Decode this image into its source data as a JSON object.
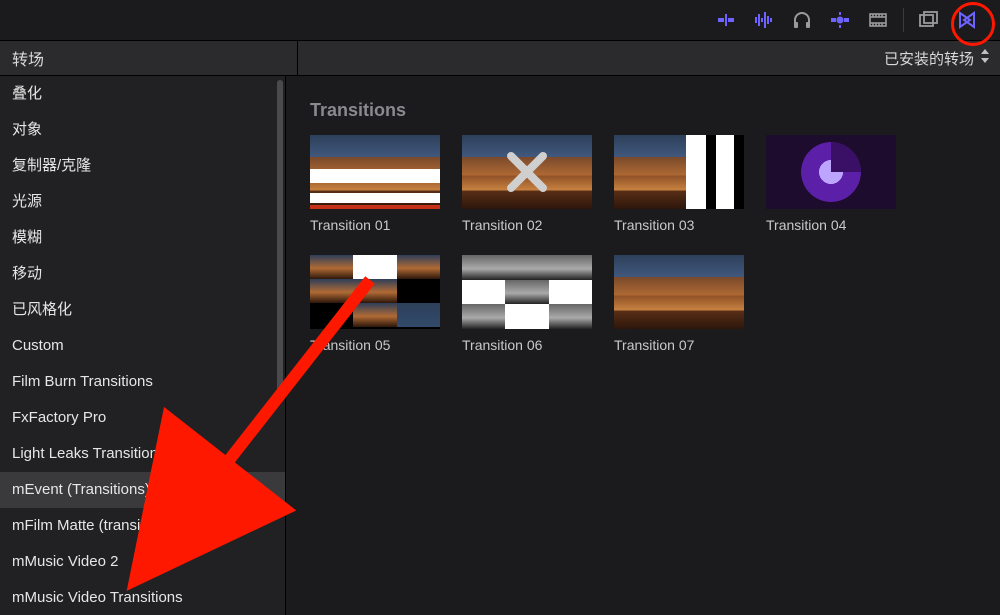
{
  "header": {
    "category_label": "转场",
    "filter_label": "已安装的转场"
  },
  "sidebar": {
    "items": [
      {
        "label": "叠化",
        "selected": false
      },
      {
        "label": "对象",
        "selected": false
      },
      {
        "label": "复制器/克隆",
        "selected": false
      },
      {
        "label": "光源",
        "selected": false
      },
      {
        "label": "模糊",
        "selected": false
      },
      {
        "label": "移动",
        "selected": false
      },
      {
        "label": "已风格化",
        "selected": false
      },
      {
        "label": "Custom",
        "selected": false
      },
      {
        "label": "Film Burn Transitions",
        "selected": false
      },
      {
        "label": "FxFactory Pro",
        "selected": false
      },
      {
        "label": "Light Leaks Transitions",
        "selected": false
      },
      {
        "label": "mEvent (Transitions)",
        "selected": true
      },
      {
        "label": "mFilm Matte (transitions)",
        "selected": false
      },
      {
        "label": "mMusic Video 2",
        "selected": false
      },
      {
        "label": "mMusic Video Transitions",
        "selected": false
      }
    ]
  },
  "main": {
    "section_title": "Transitions",
    "transitions": [
      {
        "label": "Transition 01"
      },
      {
        "label": "Transition 02"
      },
      {
        "label": "Transition 03"
      },
      {
        "label": "Transition 04"
      },
      {
        "label": "Transition 05"
      },
      {
        "label": "Transition 06"
      },
      {
        "label": "Transition 07"
      }
    ]
  },
  "toolbar": {
    "accent": "#6e63ff"
  }
}
